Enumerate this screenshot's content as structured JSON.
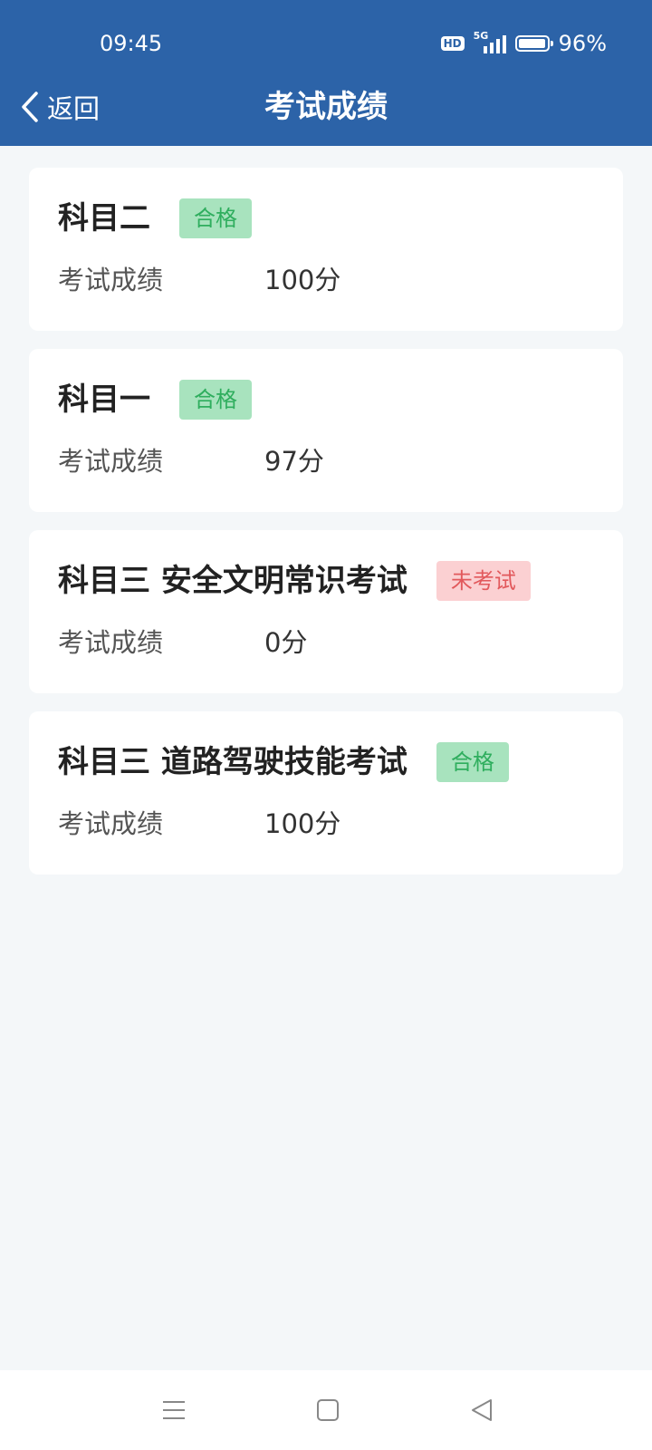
{
  "status_bar": {
    "time": "09:45",
    "hd_label": "HD",
    "network_label": "5G",
    "battery_percent_text": "96%",
    "battery_level": 0.96
  },
  "header": {
    "back_label": "返回",
    "title": "考试成绩"
  },
  "results": [
    {
      "subject": "科目二",
      "status": "合格",
      "status_type": "pass",
      "score_label": "考试成绩",
      "score": "100分"
    },
    {
      "subject": "科目一",
      "status": "合格",
      "status_type": "pass",
      "score_label": "考试成绩",
      "score": "97分"
    },
    {
      "subject": "科目三 安全文明常识考试",
      "status": "未考试",
      "status_type": "fail",
      "score_label": "考试成绩",
      "score": "0分"
    },
    {
      "subject": "科目三 道路驾驶技能考试",
      "status": "合格",
      "status_type": "pass",
      "score_label": "考试成绩",
      "score": "100分"
    }
  ],
  "navigation": {
    "icons": [
      "menu-icon",
      "home-square-icon",
      "back-triangle-icon"
    ]
  },
  "colors": {
    "header_bg": "#2c63a8",
    "page_bg": "#f4f7f9",
    "pass_bg": "#a8e3be",
    "pass_text": "#2fae5e",
    "fail_bg": "#fbd0d2",
    "fail_text": "#e2595c"
  }
}
